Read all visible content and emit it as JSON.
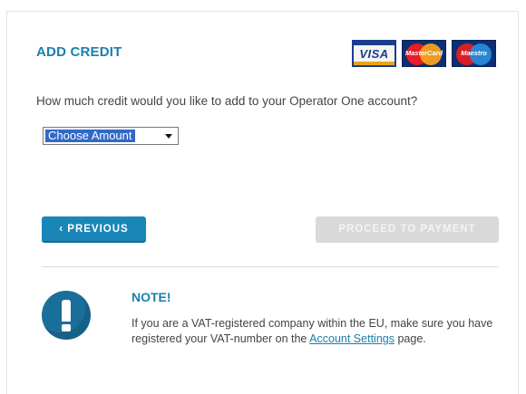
{
  "title": "ADD CREDIT",
  "cards": {
    "visa": "VISA",
    "mastercard": "MasterCard",
    "maestro": "Maestro"
  },
  "question": "How much credit would you like to add to your Operator One account?",
  "amount_select": {
    "selected": "Choose Amount"
  },
  "buttons": {
    "previous": "‹ PREVIOUS",
    "proceed": "PROCEED TO PAYMENT"
  },
  "note": {
    "title": "NOTE!",
    "text_before": "If you are a VAT-registered company within the EU, make sure you have registered your VAT-number on the ",
    "link": "Account Settings",
    "text_after": " page."
  },
  "colors": {
    "accent": "#1a7fad",
    "button_primary": "#1a86b8",
    "button_disabled": "#d9d9d9"
  }
}
